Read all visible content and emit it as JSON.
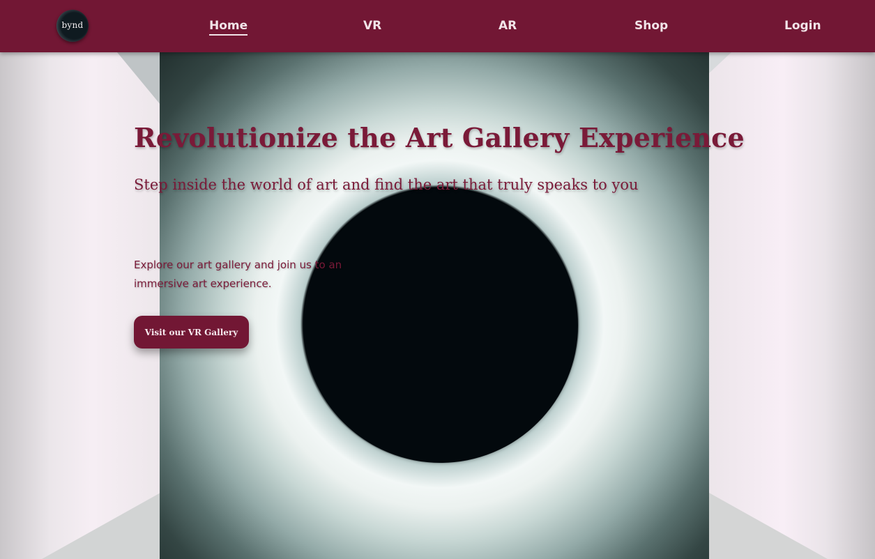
{
  "brand": {
    "logo_text": "bynd"
  },
  "nav": {
    "home": "Home",
    "vr": "VR",
    "ar": "AR",
    "shop": "Shop",
    "login": "Login"
  },
  "hero": {
    "title": "Revolutionize the Art Gallery Experience",
    "subtitle": "Step inside the world of art and find the art that truly speaks to you",
    "blurb": "Explore our art gallery and join us to an immersive art experience.",
    "cta_label": "Visit our VR Gallery"
  },
  "colors": {
    "brand": "#721734",
    "text_accent": "#7a1a38",
    "nav_text": "#f1e4e8"
  }
}
